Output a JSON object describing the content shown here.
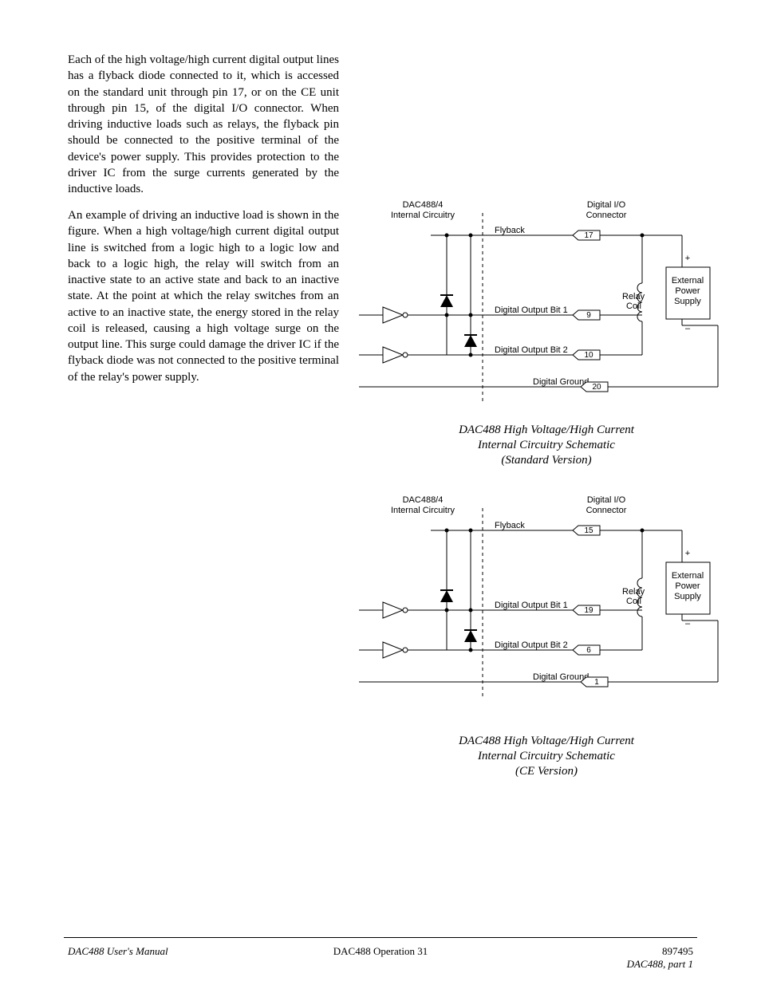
{
  "para1": "Each of the high voltage/high current digital output lines has a flyback diode connected to it, which is accessed on the standard unit through pin 17, or on the CE unit through pin 15, of the digital I/O connector. When driving inductive loads such as relays, the flyback pin should be connected to the positive terminal of the device's power supply. This provides protection to the driver IC from the surge currents generated by the inductive loads.",
  "para2": "An example of driving an inductive load is shown in the figure. When a high voltage/high current digital output line is switched from a logic high to a logic low and back to a logic high, the relay will switch from an inactive state to an active state and back to an inactive state. At the point at which the relay switches from an active to an inactive state, the energy stored in the relay coil is released, causing a high voltage surge on the output line. This surge could damage the driver IC if the flyback diode was not connected to the positive terminal of the relay's power supply.",
  "fig1": {
    "dev": "DAC488/4",
    "devsub": "Internal Circuitry",
    "conn": "Digital I/O",
    "connsub": "Connector",
    "flyback": "Flyback",
    "flyback_pin": "17",
    "dob1": "Digital Output Bit 1",
    "dob1_pin": "9",
    "dob2": "Digital Output Bit 2",
    "dob2_pin": "10",
    "gnd": "Digital Ground",
    "gnd_pin": "20",
    "relay": "Relay",
    "relaysub": "Coil",
    "plus": "+",
    "minus": "–",
    "ext1": "External",
    "ext2": "Power",
    "ext3": "Supply",
    "cap1": "DAC488 High Voltage/High Current",
    "cap2": "Internal Circuitry Schematic",
    "cap3": "(Standard Version)"
  },
  "fig2": {
    "dev": "DAC488/4",
    "devsub": "Internal Circuitry",
    "conn": "Digital I/O",
    "connsub": "Connector",
    "flyback": "Flyback",
    "flyback_pin": "15",
    "dob1": "Digital Output Bit 1",
    "dob1_pin": "19",
    "dob2": "Digital Output Bit 2",
    "dob2_pin": "6",
    "gnd": "Digital Ground",
    "gnd_pin": "1",
    "relay": "Relay",
    "relaysub": "Coil",
    "plus": "+",
    "minus": "–",
    "ext1": "External",
    "ext2": "Power",
    "ext3": "Supply",
    "cap1": "DAC488 High Voltage/High Current",
    "cap2": "Internal Circuitry Schematic",
    "cap3": "(CE Version)"
  },
  "footer": {
    "left": "DAC488 User's Manual",
    "center": "DAC488 Operation   31",
    "right_ref": "897495",
    "right_title": "DAC488, part 1"
  }
}
